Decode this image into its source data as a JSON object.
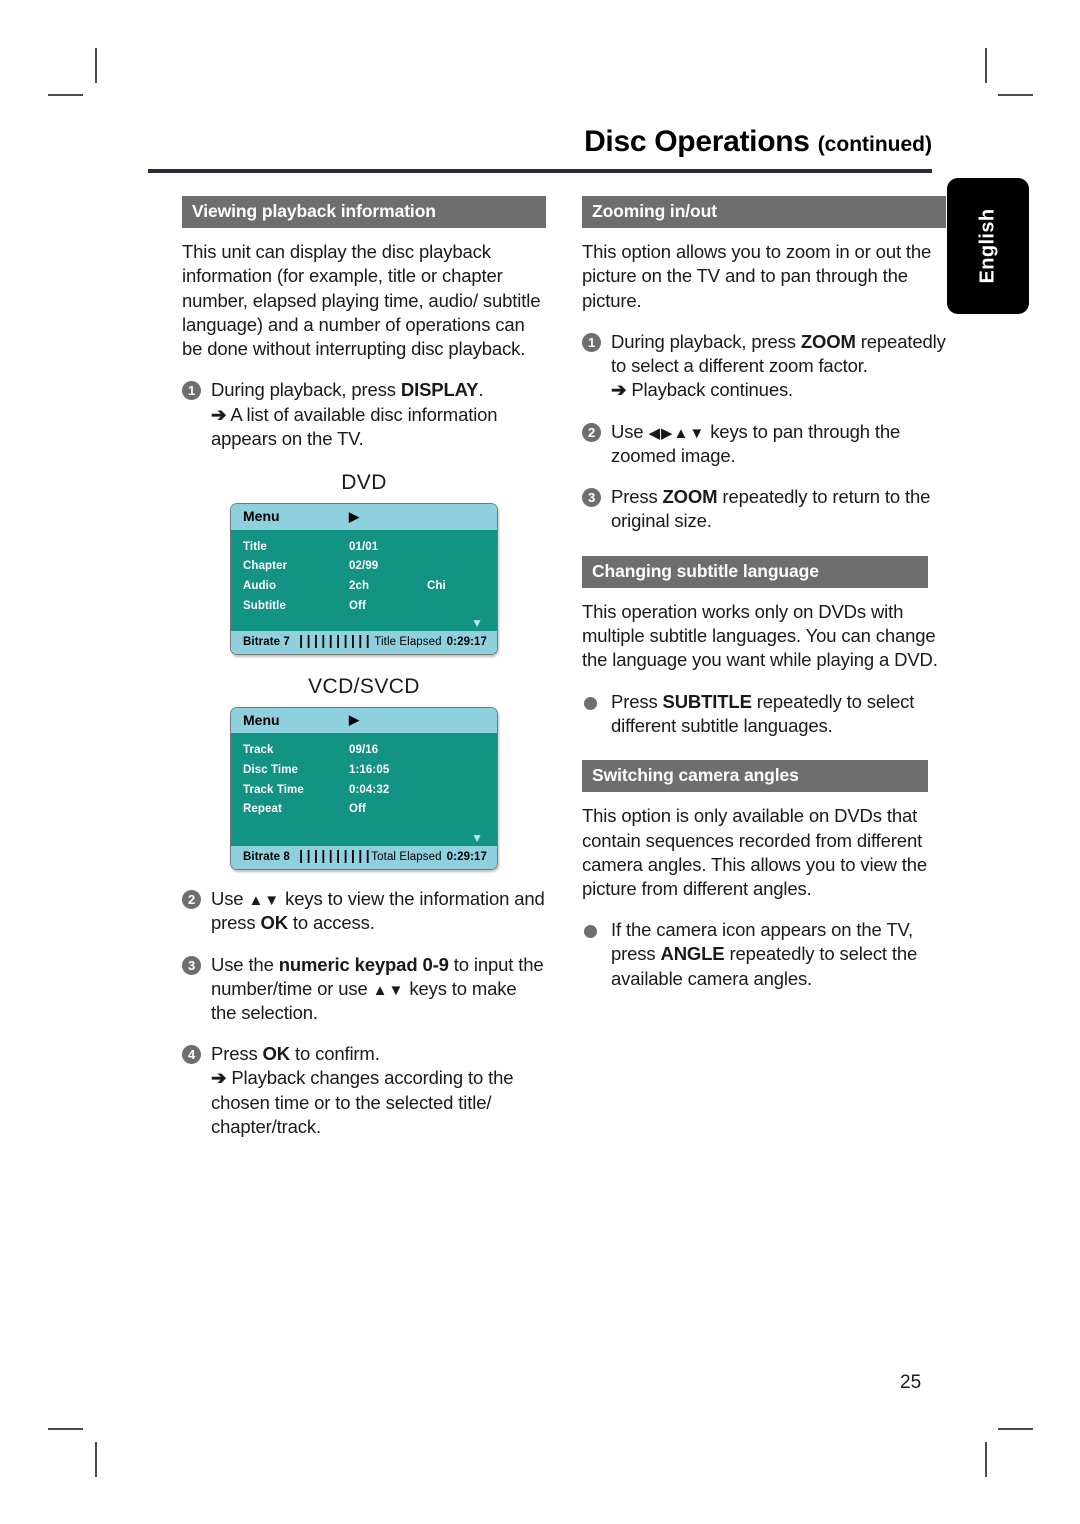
{
  "page": {
    "title": "Disc Operations",
    "title_suffix": "(continued)",
    "number": "25",
    "language_tab": "English"
  },
  "left_column": {
    "section1": {
      "heading": "Viewing playback information",
      "intro": "This unit can display the disc playback information (for example, title or chapter number, elapsed playing time, audio/ subtitle language) and a number of operations can be done without interrupting disc playback.",
      "steps": [
        {
          "num": "1",
          "text_before": "During playback, press ",
          "bold": "DISPLAY",
          "text_after": ".",
          "result_arrow": "➔",
          "result": "A list of available disc information appears on the TV."
        },
        {
          "num": "2",
          "text_before": "Use ",
          "keys": "▲▼",
          "text_mid": " keys to view the information and press ",
          "bold": "OK",
          "text_after": " to access."
        },
        {
          "num": "3",
          "text_before": "Use the ",
          "bold": "numeric keypad 0-9",
          "text_mid": " to input the number/time or use ",
          "keys": "▲▼",
          "text_after": " keys to make the selection."
        },
        {
          "num": "4",
          "text_before": "Press ",
          "bold": "OK",
          "text_after": " to confirm.",
          "result_arrow": "➔",
          "result": "Playback changes according to the chosen time or to the selected title/ chapter/track."
        }
      ]
    },
    "osd_dvd": {
      "label": "DVD",
      "menu_label": "Menu",
      "play_glyph": "▶",
      "rows": [
        {
          "key": "Title",
          "value": "01/01",
          "value2": ""
        },
        {
          "key": "Chapter",
          "value": "02/99",
          "value2": ""
        },
        {
          "key": "Audio",
          "value": "2ch",
          "value2": "Chi"
        },
        {
          "key": "Subtitle",
          "value": "Off",
          "value2": ""
        }
      ],
      "caret": "▼",
      "bitrate_label": "Bitrate 7",
      "bitrate_bars": "||||||||||",
      "elapsed_label": "Title Elapsed",
      "elapsed_time": "0:29:17"
    },
    "osd_vcd": {
      "label": "VCD/SVCD",
      "menu_label": "Menu",
      "play_glyph": "▶",
      "rows": [
        {
          "key": "Track",
          "value": "09/16",
          "value2": ""
        },
        {
          "key": "Disc Time",
          "value": "1:16:05",
          "value2": ""
        },
        {
          "key": "Track Time",
          "value": "0:04:32",
          "value2": ""
        },
        {
          "key": "Repeat",
          "value": "Off",
          "value2": ""
        }
      ],
      "caret": "▼",
      "bitrate_label": "Bitrate 8",
      "bitrate_bars": "||||||||||",
      "elapsed_label": "Total Elapsed",
      "elapsed_time": "0:29:17"
    }
  },
  "right_column": {
    "section_zoom": {
      "heading": "Zooming in/out",
      "intro": "This option allows you to zoom in or out the picture on the TV and to pan through the picture.",
      "steps": [
        {
          "num": "1",
          "text_before": "During playback, press ",
          "bold": "ZOOM",
          "text_after": " repeatedly to select a different zoom factor.",
          "result_arrow": "➔",
          "result": "Playback continues."
        },
        {
          "num": "2",
          "text_before": "Use ",
          "keys": "◀▶▲▼",
          "text_after": " keys to pan through the zoomed image."
        },
        {
          "num": "3",
          "text_before": "Press ",
          "bold": "ZOOM",
          "text_after": " repeatedly to return to the original size."
        }
      ]
    },
    "section_subtitle": {
      "heading": "Changing subtitle language",
      "intro": "This operation works only on DVDs with multiple subtitle languages. You can change the language you want while playing a DVD.",
      "bullet": {
        "text_before": "Press ",
        "bold": "SUBTITLE",
        "text_after": " repeatedly to select different subtitle languages."
      }
    },
    "section_angles": {
      "heading": "Switching camera angles",
      "intro": "This option is only available on DVDs that contain sequences recorded from different camera angles. This allows you to view the picture from different angles.",
      "bullet": {
        "text_before": "If the camera icon appears on the TV, press ",
        "bold": "ANGLE",
        "text_after": " repeatedly to select the available camera angles."
      }
    }
  },
  "colors": {
    "section_header_bg": "#6e6e6e",
    "osd_header_bg": "#8fd0de",
    "osd_body_bg": "#129384",
    "rule": "#2b2b3a",
    "tab_bg": "#000000"
  }
}
